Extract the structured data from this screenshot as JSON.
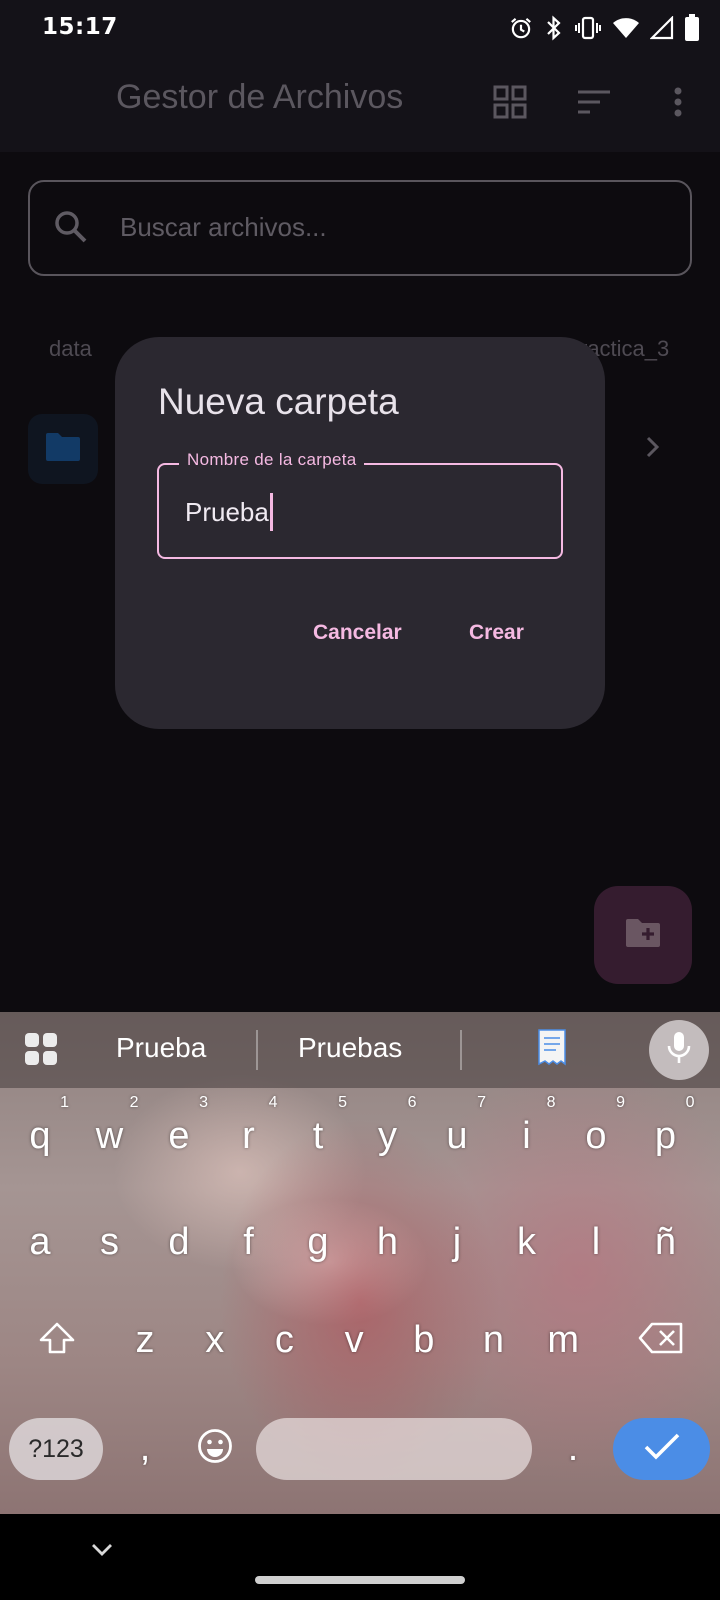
{
  "status_bar": {
    "time": "15:17"
  },
  "app_bar": {
    "title": "Gestor de Archivos",
    "actions": [
      "grid-view-icon",
      "sort-icon",
      "more-vert-icon"
    ]
  },
  "search": {
    "placeholder": "Buscar archivos..."
  },
  "breadcrumb": {
    "first": "data",
    "last": "ractica_3"
  },
  "dialog": {
    "title": "Nueva carpeta",
    "field_label": "Nombre de la carpeta",
    "field_value": "Prueba",
    "cancel_label": "Cancelar",
    "create_label": "Crear"
  },
  "keyboard": {
    "suggestions": [
      "Prueba",
      "Pruebas"
    ],
    "row1": [
      {
        "k": "q",
        "n": "1"
      },
      {
        "k": "w",
        "n": "2"
      },
      {
        "k": "e",
        "n": "3"
      },
      {
        "k": "r",
        "n": "4"
      },
      {
        "k": "t",
        "n": "5"
      },
      {
        "k": "y",
        "n": "6"
      },
      {
        "k": "u",
        "n": "7"
      },
      {
        "k": "i",
        "n": "8"
      },
      {
        "k": "o",
        "n": "9"
      },
      {
        "k": "p",
        "n": "0"
      }
    ],
    "row2": [
      "a",
      "s",
      "d",
      "f",
      "g",
      "h",
      "j",
      "k",
      "l",
      "ñ"
    ],
    "row3": [
      "z",
      "x",
      "c",
      "v",
      "b",
      "n",
      "m"
    ],
    "symbols_label": "?123",
    "comma": ",",
    "period": "."
  },
  "colors": {
    "accent": "#f5b9e2",
    "dialog_bg": "#2b2830",
    "enter_key": "#4b8de6"
  }
}
